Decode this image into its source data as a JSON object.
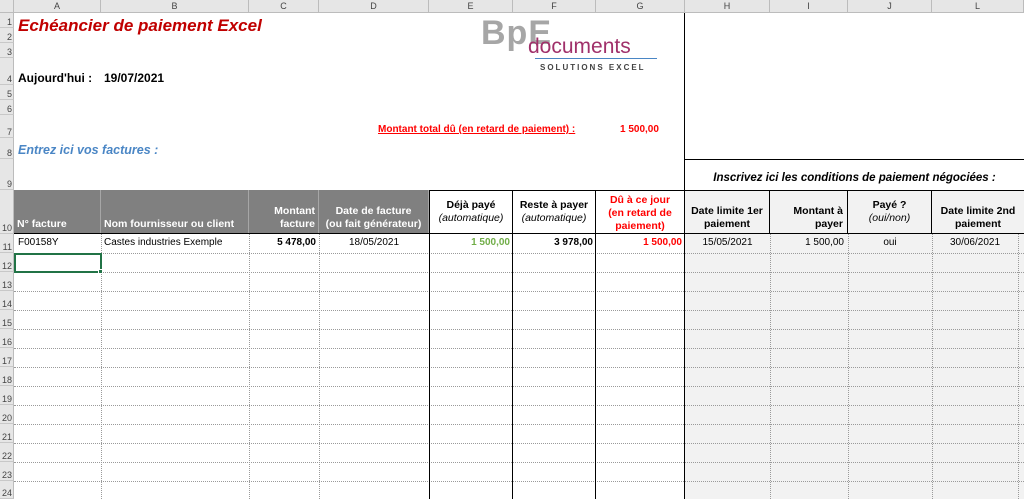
{
  "sheet": {
    "columns": [
      "A",
      "B",
      "C",
      "D",
      "E",
      "F",
      "G",
      "H",
      "I",
      "J",
      "L"
    ],
    "rows": [
      "1",
      "2",
      "3",
      "4",
      "5",
      "6",
      "7",
      "8",
      "9",
      "10",
      "11",
      "12",
      "13",
      "14",
      "15",
      "16",
      "17",
      "18",
      "19",
      "20",
      "21",
      "22",
      "23",
      "24"
    ]
  },
  "header": {
    "title": "Echéancier de paiement Excel",
    "today_label": "Aujourd'hui :",
    "today_value": "19/07/2021",
    "total_label": "Montant total dû (en retard de paiement) :",
    "total_value": "1 500,00",
    "enter_invoices": "Entrez ici vos factures :",
    "conditions_title": "Inscrivez ici les conditions de paiement négociées :"
  },
  "logo": {
    "bp": "BpE",
    "documents": "documents",
    "subtitle": "SOLUTIONS EXCEL"
  },
  "table": {
    "headers": {
      "invoice_no": "N° facture",
      "supplier": "Nom fournisseur ou client",
      "amount_l1": "Montant",
      "amount_l2": "facture",
      "date_l1": "Date de facture",
      "date_l2": "(ou fait générateur)",
      "paid_l1": "Déjà payé",
      "paid_l2": "(automatique)",
      "remaining_l1": "Reste à payer",
      "remaining_l2": "(automatique)",
      "due_l1": "Dû à ce jour",
      "due_l2": "(en retard de",
      "due_l3": "paiement)",
      "deadline1_l1": "Date limite 1er",
      "deadline1_l2": "paiement",
      "pay_amount_l1": "Montant à",
      "pay_amount_l2": "payer",
      "paid_q_l1": "Payé ?",
      "paid_q_l2": "(oui/non)",
      "deadline2_l1": "Date limite 2nd",
      "deadline2_l2": "paiement"
    },
    "row": {
      "invoice_no": "F00158Y",
      "supplier": "Castes industries Exemple",
      "amount": "5 478,00",
      "date": "18/05/2021",
      "paid": "1 500,00",
      "remaining": "3 978,00",
      "due": "1 500,00",
      "deadline1": "15/05/2021",
      "pay_amount": "1 500,00",
      "paid_q": "oui",
      "deadline2": "30/06/2021"
    }
  },
  "colors": {
    "title_red": "#c00000",
    "blue_label": "#4a86c5",
    "header_gray": "#808080",
    "paid_green": "#70ad47",
    "selection_green": "#217346"
  }
}
